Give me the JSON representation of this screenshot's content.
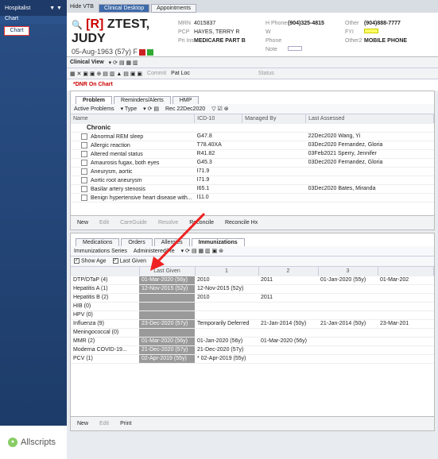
{
  "leftnav": {
    "header": "Hospitalist",
    "section": "Chart",
    "chart_item": "Chart",
    "logo": "Allscripts"
  },
  "top_tabs": {
    "hide": "Hide VTB",
    "tabs": [
      "Clinical Desktop",
      "Appointments"
    ]
  },
  "patient": {
    "flag": "[R]",
    "name": "ZTEST, JUDY",
    "dob": "05-Aug-1963 (57y) F",
    "mrn_k": "MRN",
    "mrn": "4015837",
    "pcp_k": "PCP",
    "pcp": "HAYES, TERRY R",
    "plan_k": "Pri Ins",
    "plan": "MEDICARE PART B",
    "hphone_k": "H Phone",
    "hphone": "(904)325-4815",
    "wphone_k": "W Phone",
    "note_k": "Note",
    "other_k": "Other",
    "other": "(904)888-7777",
    "fyi_k": "FYI",
    "other2_k": "Other2",
    "other2": "MOBILE PHONE"
  },
  "clinical": {
    "view": "Clinical View",
    "commit": "Commit",
    "patloc": "Pat Loc",
    "status": "Status",
    "dnr": "*DNR On Chart"
  },
  "problem_tabs": [
    "Problem",
    "Reminders/Alerts",
    "HMP"
  ],
  "problem_bar": {
    "filter": "Active Problems",
    "type": "Type",
    "rec": "Rec 22Dec2020"
  },
  "problem_cols": [
    "Name",
    "ICD-10",
    "Managed By",
    "Last Assessed"
  ],
  "problem_group": "Chronic",
  "problems": [
    {
      "name": "Abnormal REM sleep",
      "icd": "G47.8",
      "last": "22Dec2020 Wang, Yi"
    },
    {
      "name": "Allergic reaction",
      "icd": "T78.40XA",
      "last": "03Dec2020 Fernandez, Gloria"
    },
    {
      "name": "Altered mental status",
      "icd": "R41.82",
      "last": "03Feb2021 Sperry, Jennifer"
    },
    {
      "name": "Amaurosis fugax, both eyes",
      "icd": "G45.3",
      "last": "03Dec2020 Fernandez, Gloria"
    },
    {
      "name": "Aneurysm, aortic",
      "icd": "I71.9",
      "last": ""
    },
    {
      "name": "Aortic root aneurysm",
      "icd": "I71.9",
      "last": ""
    },
    {
      "name": "Basilar artery stenosis",
      "icd": "I65.1",
      "last": "03Dec2020 Bates, Miranda"
    },
    {
      "name": "Benign hypertensive heart disease with...",
      "icd": "I11.0",
      "last": ""
    }
  ],
  "problem_buttons": [
    "New",
    "Edit",
    "CareGuide",
    "Resolve",
    "Reconcile",
    "Reconcile Hx"
  ],
  "lower_tabs": [
    "Medications",
    "Orders",
    "Allergies",
    "Immunizations"
  ],
  "imm_bar": {
    "series": "Immunizations Series",
    "admin": "Administered/Re"
  },
  "imm_checks": [
    "Show Age",
    "Last Given"
  ],
  "imm_cols": [
    "Last Given",
    "1",
    "2",
    "3",
    ""
  ],
  "immunizations": [
    {
      "name": "DTP/DTaP (4)",
      "last": "01-Mar-2020 (56y)",
      "c1": "2010",
      "c2": "2011",
      "c3": "01-Jan-2020 (55y)",
      "c4": "01-Mar-202"
    },
    {
      "name": "Hepatitis A (1)",
      "last": "12-Nov-2015 (52y)",
      "c1": "12-Nov-2015 (52y)",
      "c2": "",
      "c3": "",
      "c4": ""
    },
    {
      "name": "Hepatitis B (2)",
      "last": "",
      "c1": "2010",
      "c2": "2011",
      "c3": "",
      "c4": ""
    },
    {
      "name": "HIB (0)",
      "last": "",
      "c1": "",
      "c2": "",
      "c3": "",
      "c4": ""
    },
    {
      "name": "HPV (0)",
      "last": "",
      "c1": "",
      "c2": "",
      "c3": "",
      "c4": ""
    },
    {
      "name": "Influenza (9)",
      "last": "23-Dec-2020 (57y)",
      "c1": "Temporarily Deferred",
      "c2": "21-Jan-2014 (50y)",
      "c3": "21-Jan-2014 (50y)",
      "c4": "23-Mar-201"
    },
    {
      "name": "Meningococcal (0)",
      "last": "",
      "c1": "",
      "c2": "",
      "c3": "",
      "c4": ""
    },
    {
      "name": "MMR (2)",
      "last": "01-Mar-2020 (56y)",
      "c1": "01-Jan-2020 (56y)",
      "c2": "01-Mar-2020 (56y)",
      "c3": "",
      "c4": ""
    },
    {
      "name": "Moderna COVID-19...",
      "last": "21-Dec-2020 (57y)",
      "c1": "21-Dec-2020 (57y)",
      "c2": "",
      "c3": "",
      "c4": ""
    },
    {
      "name": "PCV (1)",
      "last": "02-Apr-2019 (55y)",
      "c1": "* 02-Apr-2019 (55y)",
      "c2": "",
      "c3": "",
      "c4": ""
    }
  ],
  "imm_buttons": [
    "New",
    "Edit",
    "Print"
  ]
}
